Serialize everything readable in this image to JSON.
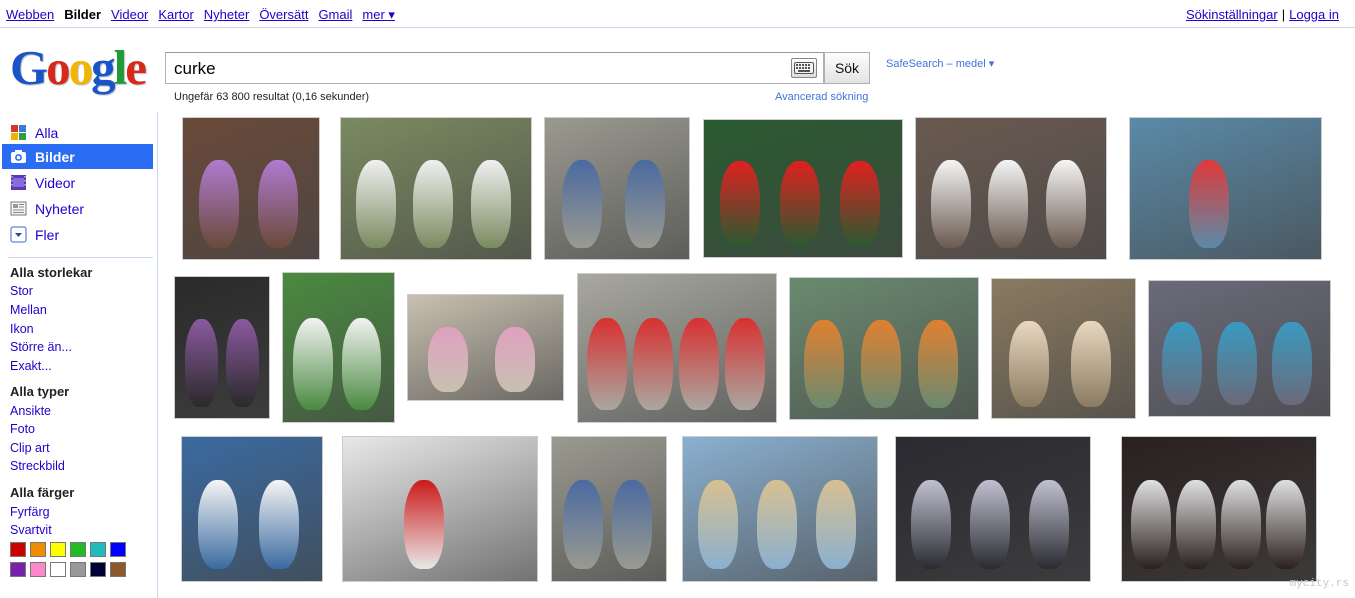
{
  "topnav": {
    "items": [
      "Webben",
      "Bilder",
      "Videor",
      "Kartor",
      "Nyheter",
      "Översätt",
      "Gmail",
      "mer ▾"
    ],
    "active_index": 1
  },
  "topright": {
    "settings": "Sökinställningar",
    "separator": "|",
    "logout": "Logga in"
  },
  "logo": {
    "text": "Google"
  },
  "search": {
    "query": "curke",
    "button": "Sök",
    "safesearch": "SafeSearch – medel ▾",
    "advanced": "Avancerad sökning",
    "result_count": "Ungefär 63 800 resultat (0,16 sekunder)"
  },
  "leftnav": {
    "items": [
      {
        "label": "Alla",
        "icon": "grid-icon"
      },
      {
        "label": "Bilder",
        "icon": "camera-icon"
      },
      {
        "label": "Videor",
        "icon": "film-icon"
      },
      {
        "label": "Nyheter",
        "icon": "newspaper-icon"
      },
      {
        "label": "Fler",
        "icon": "chevron-down-icon"
      }
    ],
    "active_index": 1
  },
  "filters": {
    "size": {
      "title": "Alla storlekar",
      "options": [
        "Stor",
        "Mellan",
        "Ikon",
        "Större än...",
        "Exakt..."
      ]
    },
    "type": {
      "title": "Alla typer",
      "options": [
        "Ansikte",
        "Foto",
        "Clip art",
        "Streckbild"
      ]
    },
    "color": {
      "title": "Alla färger",
      "options": [
        "Fyrfärg",
        "Svartvit"
      ],
      "swatches": [
        "#cc0000",
        "#f08c00",
        "#ffff00",
        "#22bb22",
        "#22bbbb",
        "#0000ff",
        "#7722aa",
        "#ff88cc",
        "#ffffff",
        "#999999",
        "#000033",
        "#8b5a2b"
      ]
    }
  },
  "thumbnails": [
    {
      "bg": "#6a4a3a",
      "accent": "#b07ad0",
      "figs": 2
    },
    {
      "bg": "#7a8a60",
      "accent": "#f0f0f0",
      "figs": 3
    },
    {
      "bg": "#9a9a90",
      "accent": "#4a6aa0",
      "figs": 2
    },
    {
      "bg": "#2a5a30",
      "accent": "#e02020",
      "figs": 3
    },
    {
      "bg": "#6a5a50",
      "accent": "#f5f5f5",
      "figs": 3
    },
    {
      "bg": "#5a8aa8",
      "accent": "#e03a3a",
      "figs": 1
    },
    {
      "bg": "#2a2a2a",
      "accent": "#8a5aa0",
      "figs": 2
    },
    {
      "bg": "#4a8a40",
      "accent": "#f2f2f2",
      "figs": 2
    },
    {
      "bg": "#c8c0b0",
      "accent": "#e0a0c0",
      "figs": 2
    },
    {
      "bg": "#a8a8a0",
      "accent": "#d83030",
      "figs": 4
    },
    {
      "bg": "#6a8a70",
      "accent": "#e08030",
      "figs": 3
    },
    {
      "bg": "#8a7a60",
      "accent": "#e8d8c0",
      "figs": 2
    },
    {
      "bg": "#6a6a7a",
      "accent": "#3a9ac0",
      "figs": 3
    },
    {
      "bg": "#3a6aa0",
      "accent": "#f5f5f5",
      "figs": 2
    },
    {
      "bg": "#e8e8e8",
      "accent": "#cc1a1a",
      "figs": 1
    },
    {
      "bg": "#9a9a90",
      "accent": "#4a6aa0",
      "figs": 2
    },
    {
      "bg": "#8ab0d0",
      "accent": "#d8c090",
      "figs": 3
    },
    {
      "bg": "#2a2a30",
      "accent": "#c0c0d0",
      "figs": 3
    },
    {
      "bg": "#2a2020",
      "accent": "#e0e0e0",
      "figs": 4
    }
  ],
  "watermark": "mycity.rs"
}
